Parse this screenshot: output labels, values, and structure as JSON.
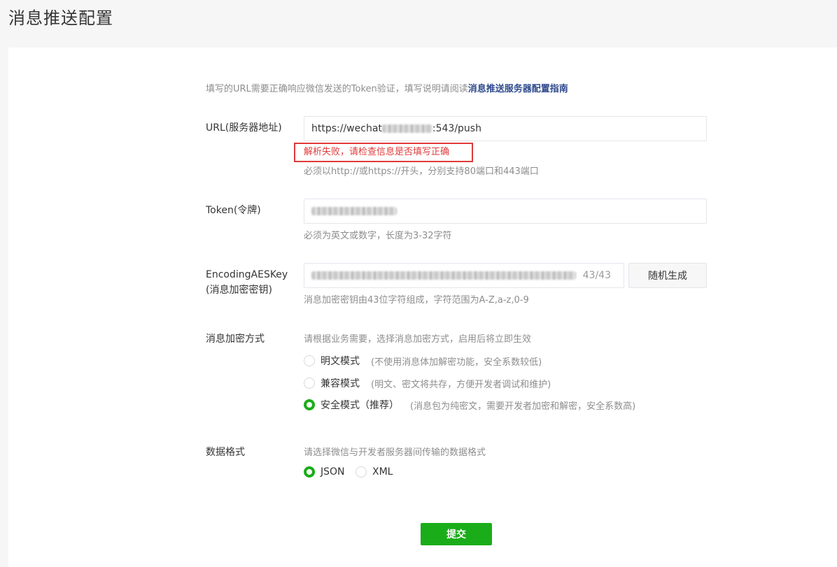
{
  "page_title": "消息推送配置",
  "intro": {
    "text": "填写的URL需要正确响应微信发送的Token验证，填写说明请阅读",
    "link": "消息推送服务器配置指南"
  },
  "url": {
    "label": "URL(服务器地址)",
    "value_prefix": "https://wechat",
    "value_suffix": ":543/push",
    "error": "解析失败，请检查信息是否填写正确",
    "hint": "必须以http://或https://开头，分别支持80端口和443端口"
  },
  "token": {
    "label": "Token(令牌)",
    "hint": "必须为英文或数字，长度为3-32字符"
  },
  "aes_key": {
    "label_line1": "EncodingAESKey",
    "label_line2": "(消息加密密钥)",
    "counter": "43/43",
    "generate_label": "随机生成",
    "hint": "消息加密密钥由43位字符组成，字符范围为A-Z,a-z,0-9"
  },
  "encryption": {
    "label": "消息加密方式",
    "hint": "请根据业务需要，选择消息加密方式，启用后将立即生效",
    "options": [
      {
        "label": "明文模式",
        "desc": "(不使用消息体加解密功能，安全系数较低)",
        "checked": false
      },
      {
        "label": "兼容模式",
        "desc": "(明文、密文将共存，方便开发者调试和维护)",
        "checked": false
      },
      {
        "label": "安全模式（推荐）",
        "desc": "(消息包为纯密文，需要开发者加密和解密，安全系数高)",
        "checked": true
      }
    ]
  },
  "data_format": {
    "label": "数据格式",
    "hint": "请选择微信与开发者服务器间传输的数据格式",
    "options": [
      {
        "label": "JSON",
        "checked": true
      },
      {
        "label": "XML",
        "checked": false
      }
    ]
  },
  "submit_label": "提交",
  "colors": {
    "accent": "#1aad19",
    "error": "#e03a3a",
    "link": "#2f4a8d"
  }
}
